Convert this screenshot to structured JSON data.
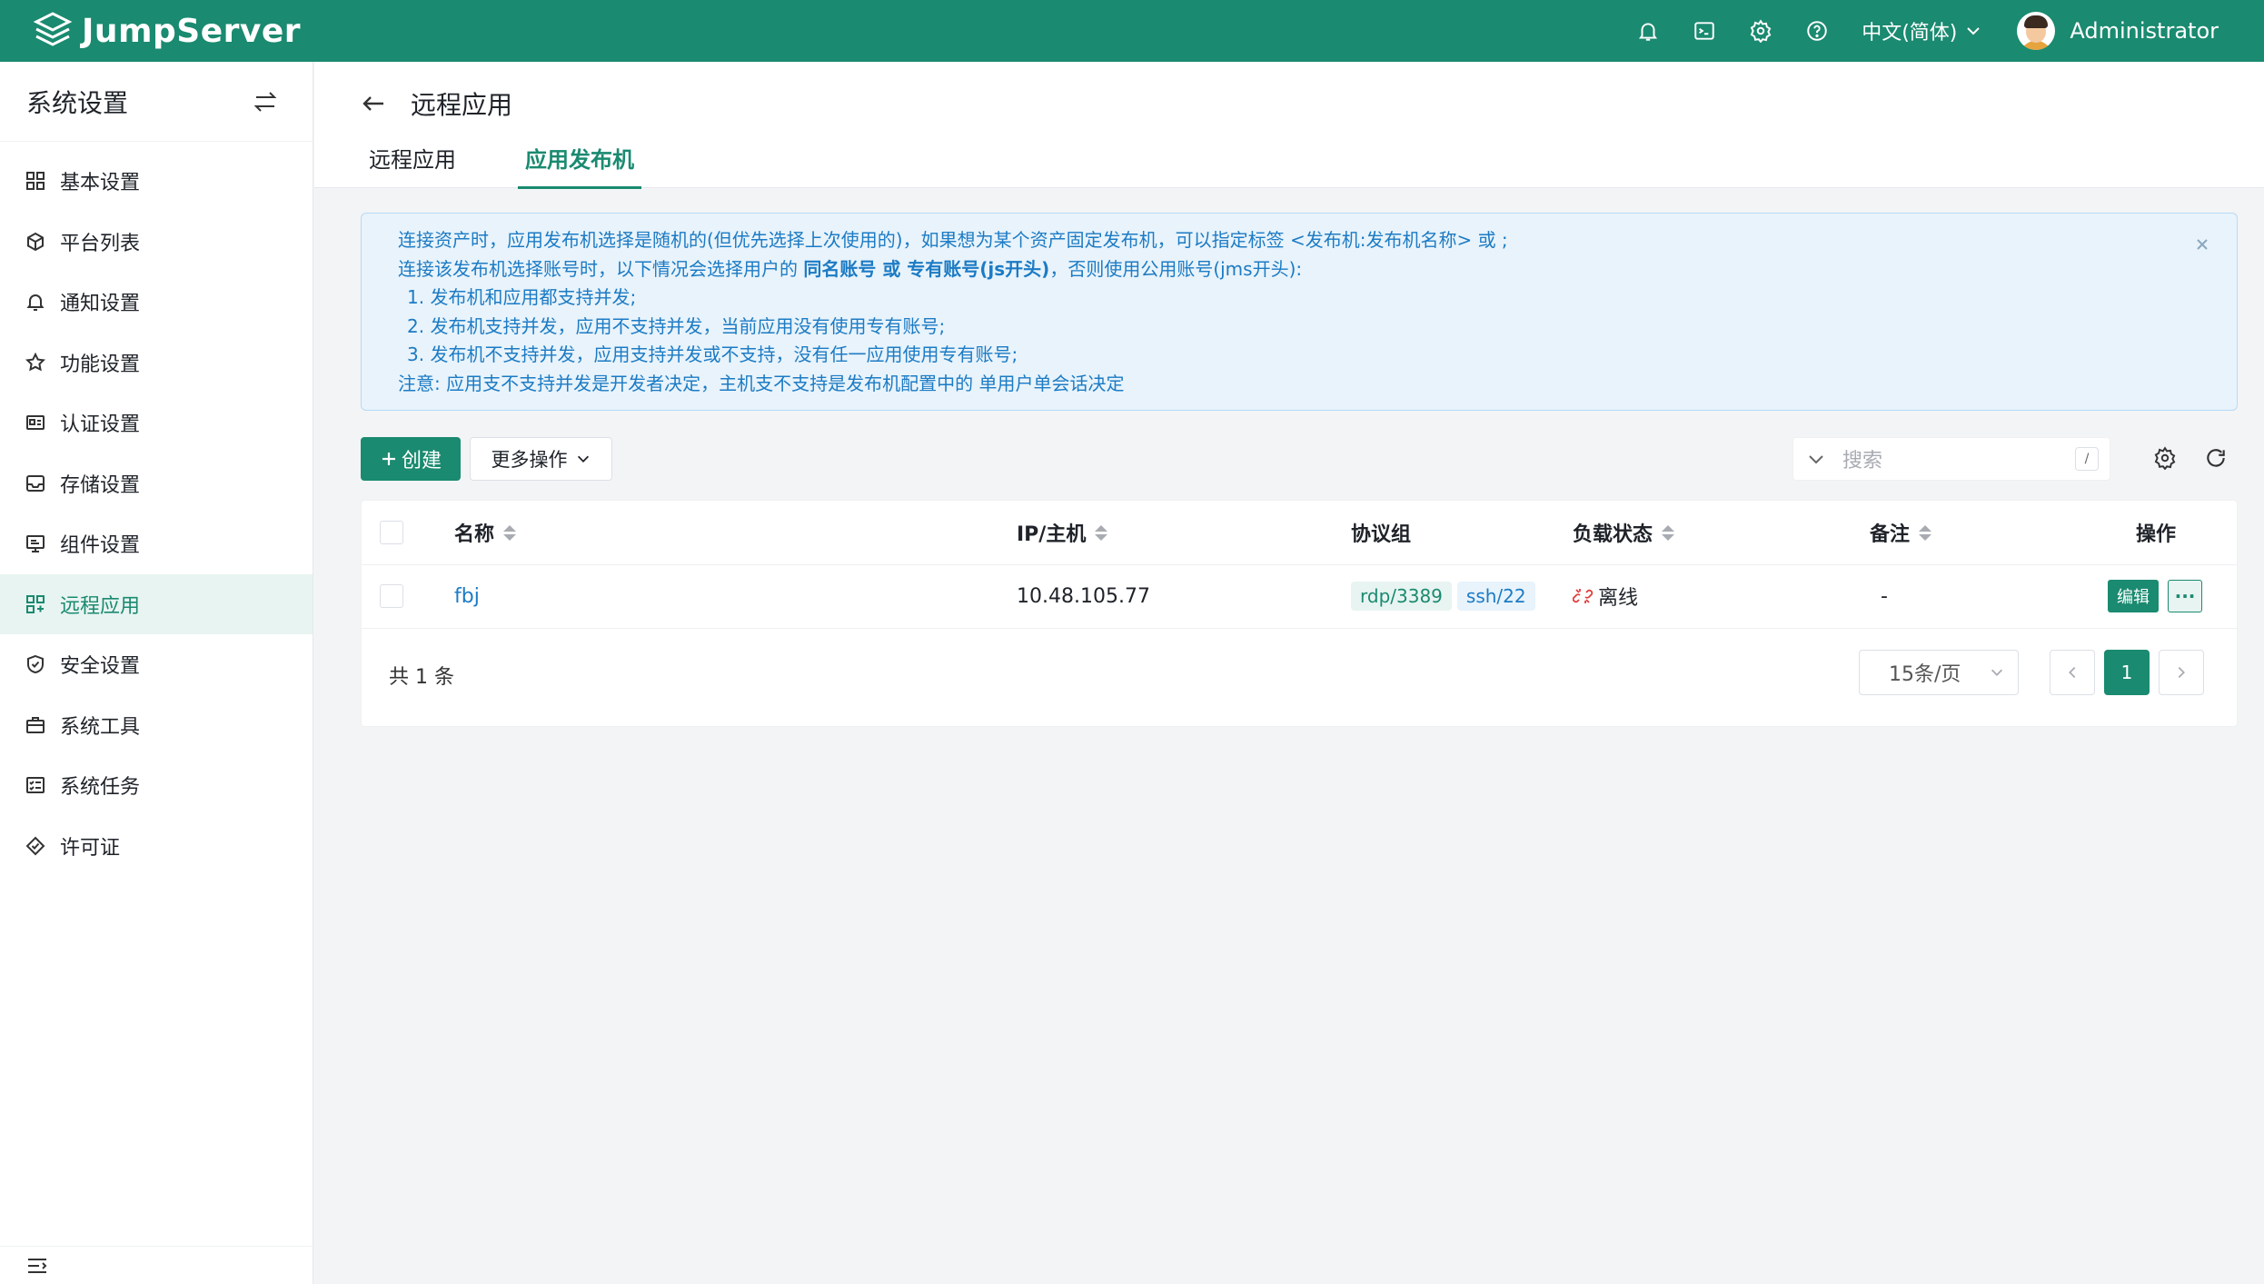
{
  "brand": {
    "name": "JumpServer",
    "color": "#1a8a70"
  },
  "header": {
    "icons": [
      "bell-icon",
      "terminal-icon",
      "gear-icon",
      "help-icon"
    ],
    "language": "中文(简体)",
    "user": "Administrator"
  },
  "sidebar": {
    "title": "系统设置",
    "items": [
      {
        "label": "基本设置",
        "icon": "grid-icon"
      },
      {
        "label": "平台列表",
        "icon": "cube-icon"
      },
      {
        "label": "通知设置",
        "icon": "bell-icon"
      },
      {
        "label": "功能设置",
        "icon": "star-icon"
      },
      {
        "label": "认证设置",
        "icon": "id-card-icon"
      },
      {
        "label": "存储设置",
        "icon": "inbox-icon"
      },
      {
        "label": "组件设置",
        "icon": "monitor-icon"
      },
      {
        "label": "远程应用",
        "icon": "apps-icon",
        "active": true
      },
      {
        "label": "安全设置",
        "icon": "shield-icon"
      },
      {
        "label": "系统工具",
        "icon": "briefcase-icon"
      },
      {
        "label": "系统任务",
        "icon": "task-list-icon"
      },
      {
        "label": "许可证",
        "icon": "license-icon"
      }
    ]
  },
  "page": {
    "title": "远程应用",
    "tabs": [
      {
        "label": "远程应用",
        "active": false
      },
      {
        "label": "应用发布机",
        "active": true
      }
    ]
  },
  "alert": {
    "line1": "连接资产时，应用发布机选择是随机的(但优先选择上次使用的)，如果想为某个资产固定发布机，可以指定标签 <发布机:发布机名称> 或 ;",
    "line2_prefix": "连接该发布机选择账号时，以下情况会选择用户的 ",
    "line2_bold": "同名账号 或 专有账号(js开头)",
    "line2_suffix": "，否则使用公用账号(jms开头):",
    "item1": "1. 发布机和应用都支持并发;",
    "item2": "2. 发布机支持并发，应用不支持并发，当前应用没有使用专有账号;",
    "item3": "3. 发布机不支持并发，应用支持并发或不支持，没有任一应用使用专有账号;",
    "note": "注意: 应用支不支持并发是开发者决定，主机支不支持是发布机配置中的 单用户单会话决定"
  },
  "toolbar": {
    "create_label": "创建",
    "more_label": "更多操作",
    "search_placeholder": "搜索",
    "search_shortcut": "/"
  },
  "table": {
    "columns": [
      "名称",
      "IP/主机",
      "协议组",
      "负载状态",
      "备注",
      "操作"
    ],
    "rows": [
      {
        "name": "fbj",
        "ip": "10.48.105.77",
        "protocols": [
          "rdp/3389",
          "ssh/22"
        ],
        "status": "离线",
        "comment": "-",
        "edit_label": "编辑",
        "more_label": "···"
      }
    ]
  },
  "pagination": {
    "total": "共 1 条",
    "page_size": "15条/页",
    "current_page": "1"
  }
}
